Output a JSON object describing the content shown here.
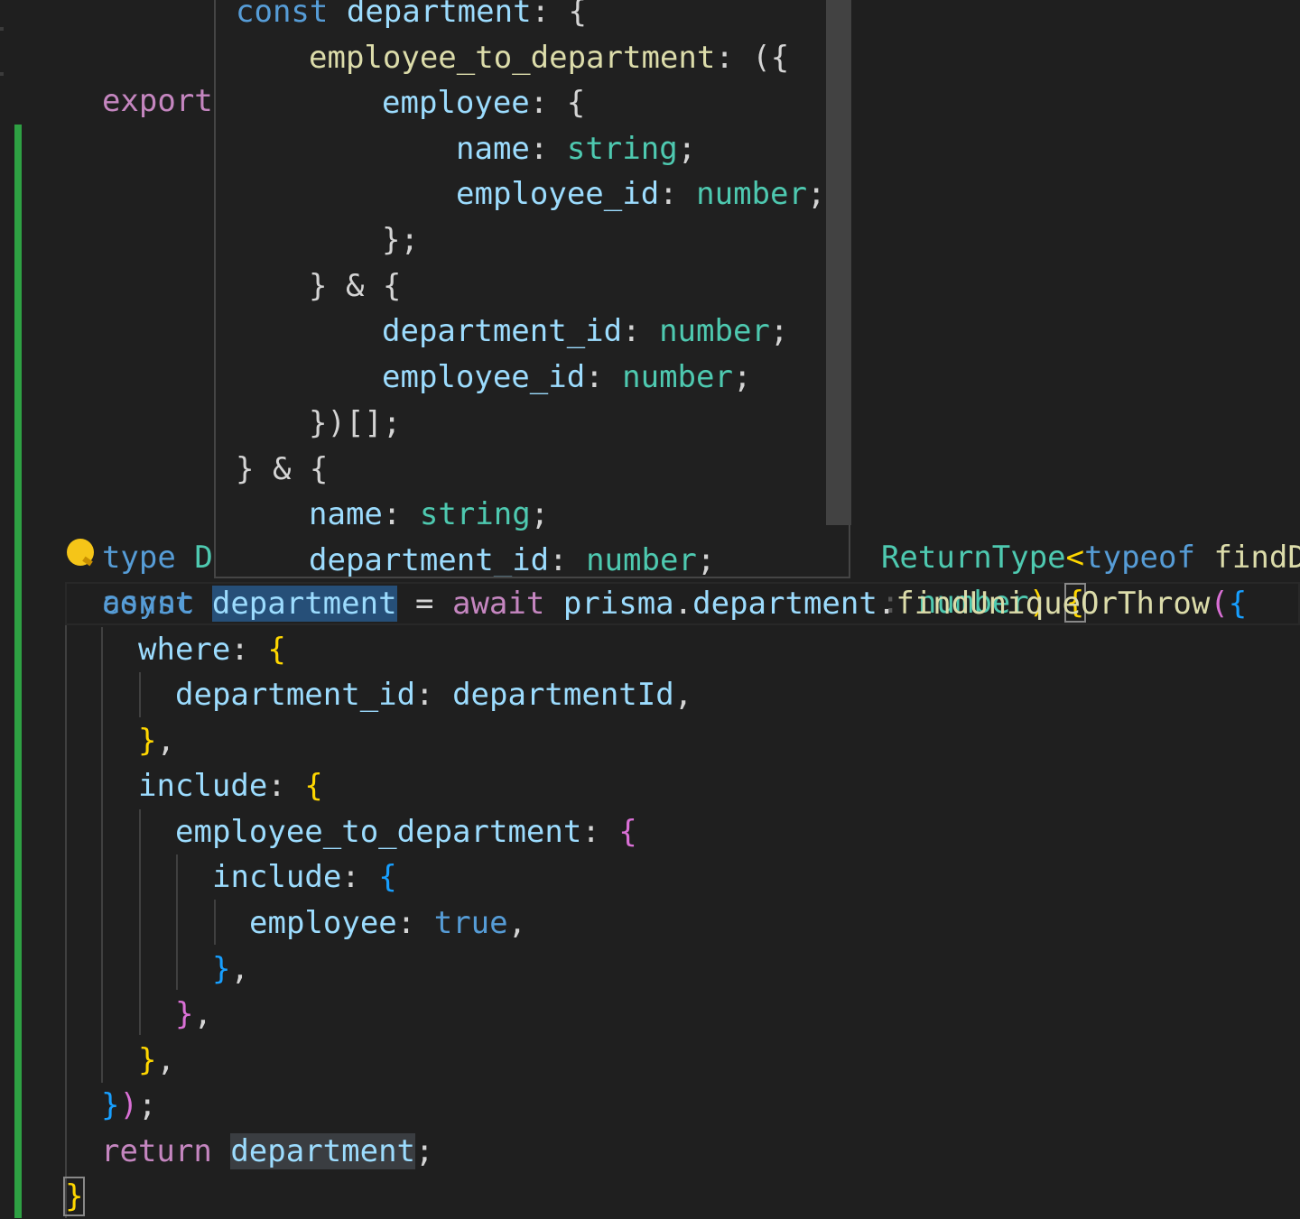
{
  "editor": {
    "line_export": "export d",
    "line_type_prefix": "type Dep",
    "line_type_suffix": "ReturnType<typeof findDep",
    "line_async_prefix": "async fu",
    "line_async_suffix": ": number) {",
    "main_lines": [
      "const department = await prisma.department.findUniqueOrThrow({",
      "where: {",
      "department_id: departmentId,",
      "},",
      "include: {",
      "employee_to_department: {",
      "include: {",
      "employee: true,",
      "},",
      "},",
      "},",
      "});",
      "return department;",
      "}"
    ]
  },
  "hover": {
    "lines": [
      "const department: {",
      "employee_to_department: ({",
      "employee: {",
      "name: string;",
      "employee_id: number;",
      "};",
      "} & {",
      "department_id: number;",
      "employee_id: number;",
      "})[];",
      "} & {",
      "name: string;",
      "department_id: number;"
    ]
  },
  "colors": {
    "background": "#1f1f1f",
    "keyword": "#569cd6",
    "control_keyword": "#c586c0",
    "variable": "#9cdcfe",
    "type": "#4ec9b0",
    "function": "#dcdcaa",
    "git_added": "#2ea043"
  },
  "icons": [
    "lightbulb-icon"
  ]
}
